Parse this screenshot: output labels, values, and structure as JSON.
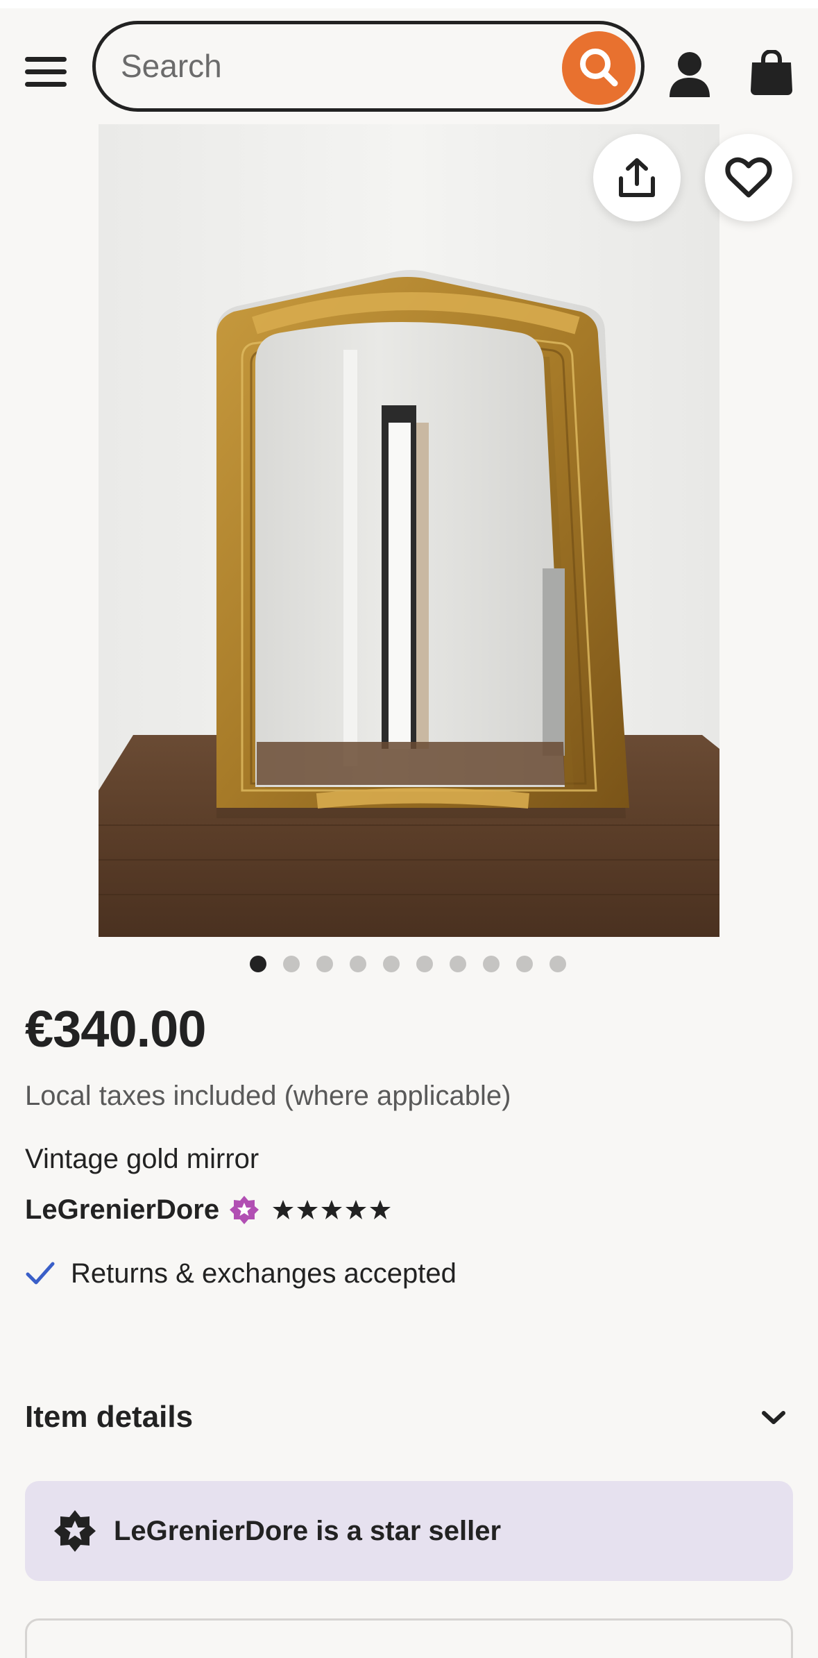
{
  "header": {
    "search_placeholder": "Search",
    "icons": [
      "menu-icon",
      "search-icon",
      "user-icon",
      "shopping-bag-icon"
    ],
    "accent_color": "#e8712f"
  },
  "gallery": {
    "image_count": 10,
    "active_index": 0,
    "action_icons": [
      "share-icon",
      "heart-icon"
    ]
  },
  "listing": {
    "price": "€340.00",
    "tax_note": "Local taxes included (where applicable)",
    "title": "Vintage gold mirror",
    "seller": "LeGrenierDore",
    "rating_stars": 5,
    "returns": "Returns & exchanges accepted"
  },
  "sections": {
    "item_details": "Item details",
    "star_seller": "LeGrenierDore is a star seller"
  },
  "colors": {
    "badge_purple": "#b14fb3",
    "check_blue": "#3a5fc8",
    "banner_bg": "#e6e1ef"
  }
}
